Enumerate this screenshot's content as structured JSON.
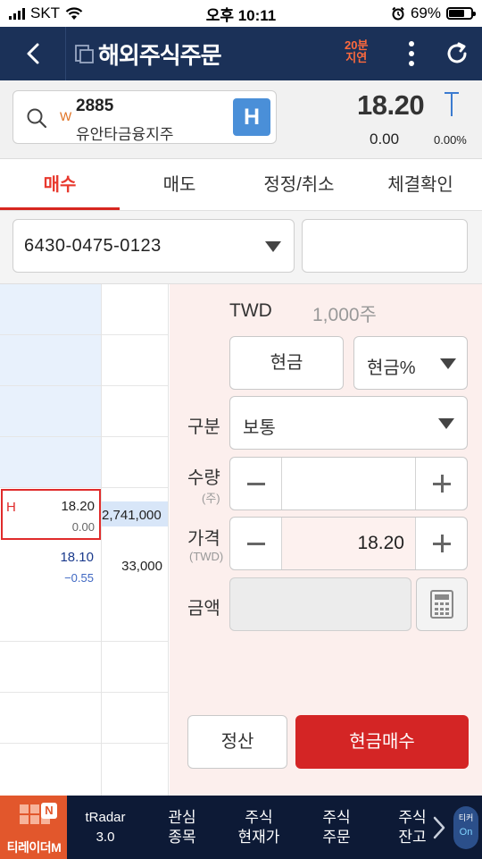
{
  "status_bar": {
    "carrier": "SKT",
    "time": "오후 10:11",
    "battery": "69%",
    "battery_level": 0.69
  },
  "header": {
    "title": "해외주식주문",
    "delay_line1": "20분",
    "delay_line2": "지연"
  },
  "stock": {
    "market_badge": "W",
    "code": "2885",
    "name": "유안타금융지주",
    "exchange_button": "H",
    "price": "18.20",
    "change": "0.00",
    "rate": "0.00%"
  },
  "tabs": [
    {
      "label": "매수",
      "active": true
    },
    {
      "label": "매도",
      "active": false
    },
    {
      "label": "정정/취소",
      "active": false
    },
    {
      "label": "체결확인",
      "active": false
    }
  ],
  "account": {
    "number": "6430-0475-0123",
    "password": ""
  },
  "order_book": {
    "ask_rows": 4,
    "current": {
      "marker": "H",
      "price": "18.20",
      "change": "0.00",
      "quantity": "2,741,000"
    },
    "bid": {
      "price": "18.10",
      "change": "−0.55",
      "quantity": "33,000"
    }
  },
  "order_panel": {
    "currency": "TWD",
    "lot_unit": "1,000주",
    "cash_button": "현금",
    "cash_percent_select": "현금%",
    "type_label": "구분",
    "type_value": "보통",
    "qty_label": "수량",
    "qty_sublabel": "(주)",
    "qty_value": "",
    "price_label": "가격",
    "price_sublabel": "(TWD)",
    "price_value": "18.20",
    "amount_label": "금액",
    "amount_value": "",
    "settle_button": "정산",
    "buy_button": "현금매수"
  },
  "bottom_nav": {
    "logo_text": "티레이더M",
    "logo_badge": "N",
    "items": [
      {
        "line1": "tRadar",
        "line2": "3.0"
      },
      {
        "line1": "관심",
        "line2": "종목"
      },
      {
        "line1": "주식",
        "line2": "현재가"
      },
      {
        "line1": "주식",
        "line2": "주문"
      },
      {
        "line1": "주식",
        "line2": "잔고"
      }
    ],
    "ticker_label": "티커",
    "ticker_state": "On"
  },
  "colors": {
    "header_bg": "#1b3158",
    "accent_red": "#d42525",
    "bid_blue": "#1a3a8c",
    "exchange_blue": "#4a8fd8"
  }
}
